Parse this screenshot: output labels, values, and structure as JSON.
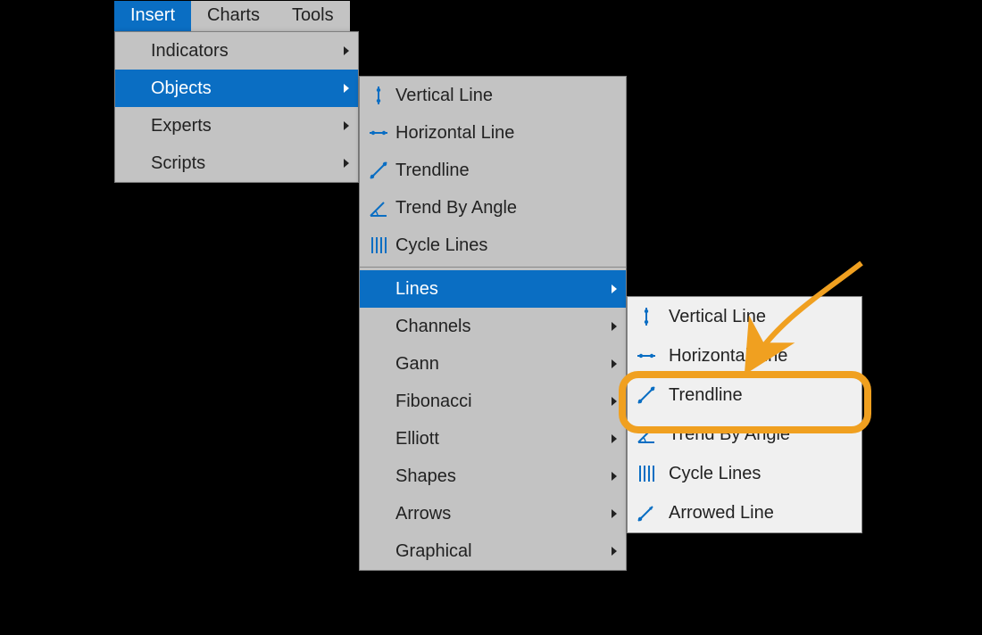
{
  "menubar": {
    "items": [
      {
        "label": "Insert",
        "selected": true
      },
      {
        "label": "Charts"
      },
      {
        "label": "Tools"
      }
    ]
  },
  "menu1": {
    "items": [
      {
        "label": "Indicators",
        "has_sub": true
      },
      {
        "label": "Objects",
        "has_sub": true,
        "selected": true
      },
      {
        "label": "Experts",
        "has_sub": true
      },
      {
        "label": "Scripts",
        "has_sub": true
      }
    ]
  },
  "menu2": {
    "groups": [
      [
        {
          "label": "Vertical Line",
          "icon": "vertical-line"
        },
        {
          "label": "Horizontal Line",
          "icon": "horizontal-line"
        },
        {
          "label": "Trendline",
          "icon": "trendline"
        },
        {
          "label": "Trend By Angle",
          "icon": "trend-angle"
        },
        {
          "label": "Cycle Lines",
          "icon": "cycle-lines"
        }
      ],
      [
        {
          "label": "Lines",
          "has_sub": true,
          "selected": true
        },
        {
          "label": "Channels",
          "has_sub": true
        },
        {
          "label": "Gann",
          "has_sub": true
        },
        {
          "label": "Fibonacci",
          "has_sub": true
        },
        {
          "label": "Elliott",
          "has_sub": true
        },
        {
          "label": "Shapes",
          "has_sub": true
        },
        {
          "label": "Arrows",
          "has_sub": true
        },
        {
          "label": "Graphical",
          "has_sub": true
        }
      ]
    ]
  },
  "menu3": {
    "items": [
      {
        "label": "Vertical Line",
        "icon": "vertical-line"
      },
      {
        "label": "Horizontal Line",
        "icon": "horizontal-line"
      },
      {
        "label": "Trendline",
        "icon": "trendline"
      },
      {
        "label": "Trend By Angle",
        "icon": "trend-angle"
      },
      {
        "label": "Cycle Lines",
        "icon": "cycle-lines"
      },
      {
        "label": "Arrowed Line",
        "icon": "arrowed-line"
      }
    ]
  }
}
